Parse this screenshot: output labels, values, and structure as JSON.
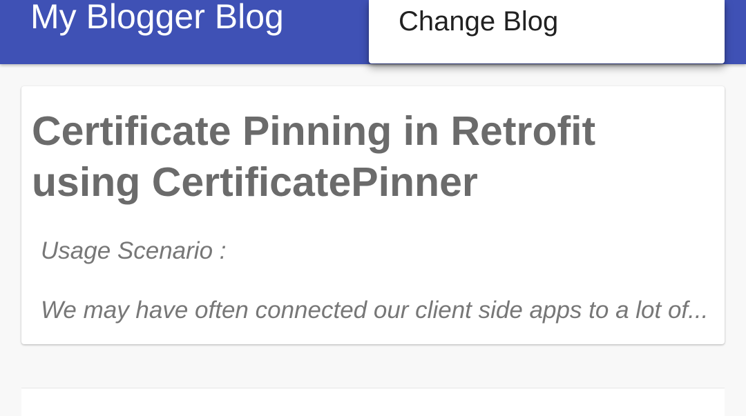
{
  "app_bar": {
    "title": "My Blogger Blog",
    "color": "#3f51b5"
  },
  "overflow_menu": {
    "items": [
      {
        "label": "Change Blog"
      }
    ]
  },
  "posts": [
    {
      "title": "Certificate Pinning in Retrofit using CertificatePinner",
      "snippet_lines": [
        "Usage Scenario :",
        "We may have often connected our client side apps to a lot of..."
      ]
    }
  ]
}
